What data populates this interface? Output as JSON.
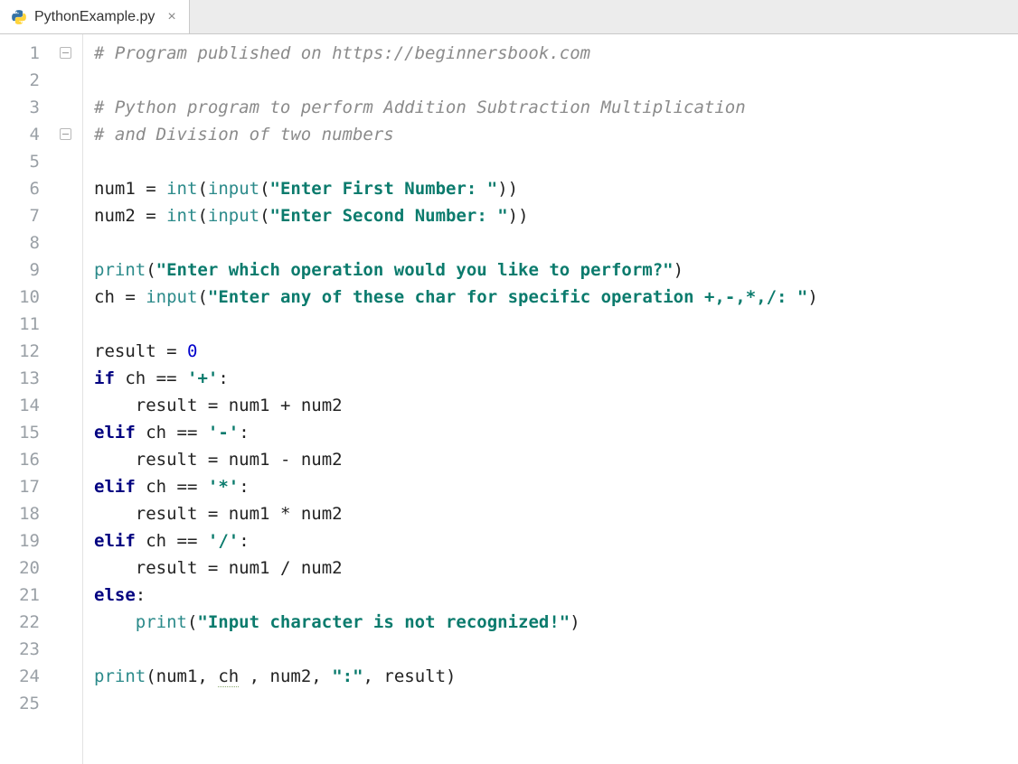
{
  "tab": {
    "filename": "PythonExample.py",
    "close_glyph": "×"
  },
  "editor": {
    "line_numbers": [
      1,
      2,
      3,
      4,
      5,
      6,
      7,
      8,
      9,
      10,
      11,
      12,
      13,
      14,
      15,
      16,
      17,
      18,
      19,
      20,
      21,
      22,
      23,
      24,
      25
    ],
    "fold_markers_at": [
      1,
      4
    ],
    "code_lines": [
      [
        {
          "t": "# Program published on https://beginnersbook.com",
          "c": "c-comment"
        }
      ],
      [],
      [
        {
          "t": "# Python program to perform Addition Subtraction Multiplication",
          "c": "c-comment"
        }
      ],
      [
        {
          "t": "# and Division of two numbers",
          "c": "c-comment"
        }
      ],
      [],
      [
        {
          "t": "num1 ",
          "c": "c-id"
        },
        {
          "t": "=",
          "c": "c-op"
        },
        {
          "t": " ",
          "c": ""
        },
        {
          "t": "int",
          "c": "c-builtin"
        },
        {
          "t": "(",
          "c": "c-op"
        },
        {
          "t": "input",
          "c": "c-builtin"
        },
        {
          "t": "(",
          "c": "c-op"
        },
        {
          "t": "\"Enter First Number: \"",
          "c": "c-str"
        },
        {
          "t": "))",
          "c": "c-op"
        }
      ],
      [
        {
          "t": "num2 ",
          "c": "c-id"
        },
        {
          "t": "=",
          "c": "c-op"
        },
        {
          "t": " ",
          "c": ""
        },
        {
          "t": "int",
          "c": "c-builtin"
        },
        {
          "t": "(",
          "c": "c-op"
        },
        {
          "t": "input",
          "c": "c-builtin"
        },
        {
          "t": "(",
          "c": "c-op"
        },
        {
          "t": "\"Enter Second Number: \"",
          "c": "c-str"
        },
        {
          "t": "))",
          "c": "c-op"
        }
      ],
      [],
      [
        {
          "t": "print",
          "c": "c-builtin"
        },
        {
          "t": "(",
          "c": "c-op"
        },
        {
          "t": "\"Enter which operation would you like to perform?\"",
          "c": "c-str"
        },
        {
          "t": ")",
          "c": "c-op"
        }
      ],
      [
        {
          "t": "ch ",
          "c": "c-id"
        },
        {
          "t": "=",
          "c": "c-op"
        },
        {
          "t": " ",
          "c": ""
        },
        {
          "t": "input",
          "c": "c-builtin"
        },
        {
          "t": "(",
          "c": "c-op"
        },
        {
          "t": "\"Enter any of these char for specific operation +,-,*,/: \"",
          "c": "c-str"
        },
        {
          "t": ")",
          "c": "c-op"
        }
      ],
      [],
      [
        {
          "t": "result ",
          "c": "c-id"
        },
        {
          "t": "=",
          "c": "c-op"
        },
        {
          "t": " ",
          "c": ""
        },
        {
          "t": "0",
          "c": "c-num"
        }
      ],
      [
        {
          "t": "if",
          "c": "c-kw"
        },
        {
          "t": " ch ",
          "c": "c-id"
        },
        {
          "t": "==",
          "c": "c-op"
        },
        {
          "t": " ",
          "c": ""
        },
        {
          "t": "'+'",
          "c": "c-str"
        },
        {
          "t": ":",
          "c": "c-op"
        }
      ],
      [
        {
          "t": "    result ",
          "c": "c-id"
        },
        {
          "t": "=",
          "c": "c-op"
        },
        {
          "t": " num1 ",
          "c": "c-id"
        },
        {
          "t": "+",
          "c": "c-op"
        },
        {
          "t": " num2",
          "c": "c-id"
        }
      ],
      [
        {
          "t": "elif",
          "c": "c-kw"
        },
        {
          "t": " ch ",
          "c": "c-id"
        },
        {
          "t": "==",
          "c": "c-op"
        },
        {
          "t": " ",
          "c": ""
        },
        {
          "t": "'-'",
          "c": "c-str"
        },
        {
          "t": ":",
          "c": "c-op"
        }
      ],
      [
        {
          "t": "    result ",
          "c": "c-id"
        },
        {
          "t": "=",
          "c": "c-op"
        },
        {
          "t": " num1 ",
          "c": "c-id"
        },
        {
          "t": "-",
          "c": "c-op"
        },
        {
          "t": " num2",
          "c": "c-id"
        }
      ],
      [
        {
          "t": "elif",
          "c": "c-kw"
        },
        {
          "t": " ch ",
          "c": "c-id"
        },
        {
          "t": "==",
          "c": "c-op"
        },
        {
          "t": " ",
          "c": ""
        },
        {
          "t": "'*'",
          "c": "c-str"
        },
        {
          "t": ":",
          "c": "c-op"
        }
      ],
      [
        {
          "t": "    result ",
          "c": "c-id"
        },
        {
          "t": "=",
          "c": "c-op"
        },
        {
          "t": " num1 ",
          "c": "c-id"
        },
        {
          "t": "*",
          "c": "c-op"
        },
        {
          "t": " num2",
          "c": "c-id"
        }
      ],
      [
        {
          "t": "elif",
          "c": "c-kw"
        },
        {
          "t": " ch ",
          "c": "c-id"
        },
        {
          "t": "==",
          "c": "c-op"
        },
        {
          "t": " ",
          "c": ""
        },
        {
          "t": "'/'",
          "c": "c-str"
        },
        {
          "t": ":",
          "c": "c-op"
        }
      ],
      [
        {
          "t": "    result ",
          "c": "c-id"
        },
        {
          "t": "=",
          "c": "c-op"
        },
        {
          "t": " num1 ",
          "c": "c-id"
        },
        {
          "t": "/",
          "c": "c-op"
        },
        {
          "t": " num2",
          "c": "c-id"
        }
      ],
      [
        {
          "t": "else",
          "c": "c-kw"
        },
        {
          "t": ":",
          "c": "c-op"
        }
      ],
      [
        {
          "t": "    ",
          "c": ""
        },
        {
          "t": "print",
          "c": "c-builtin"
        },
        {
          "t": "(",
          "c": "c-op"
        },
        {
          "t": "\"Input character is not recognized!\"",
          "c": "c-str"
        },
        {
          "t": ")",
          "c": "c-op"
        }
      ],
      [],
      [
        {
          "t": "print",
          "c": "c-builtin"
        },
        {
          "t": "(",
          "c": "c-op"
        },
        {
          "t": "num1",
          "c": "c-id"
        },
        {
          "t": ", ",
          "c": "c-op"
        },
        {
          "t": "ch",
          "c": "c-id typo-underline"
        },
        {
          "t": " , ",
          "c": "c-op"
        },
        {
          "t": "num2",
          "c": "c-id"
        },
        {
          "t": ", ",
          "c": "c-op"
        },
        {
          "t": "\":\"",
          "c": "c-str"
        },
        {
          "t": ", ",
          "c": "c-op"
        },
        {
          "t": "result",
          "c": "c-id"
        },
        {
          "t": ")",
          "c": "c-op"
        }
      ],
      []
    ]
  }
}
